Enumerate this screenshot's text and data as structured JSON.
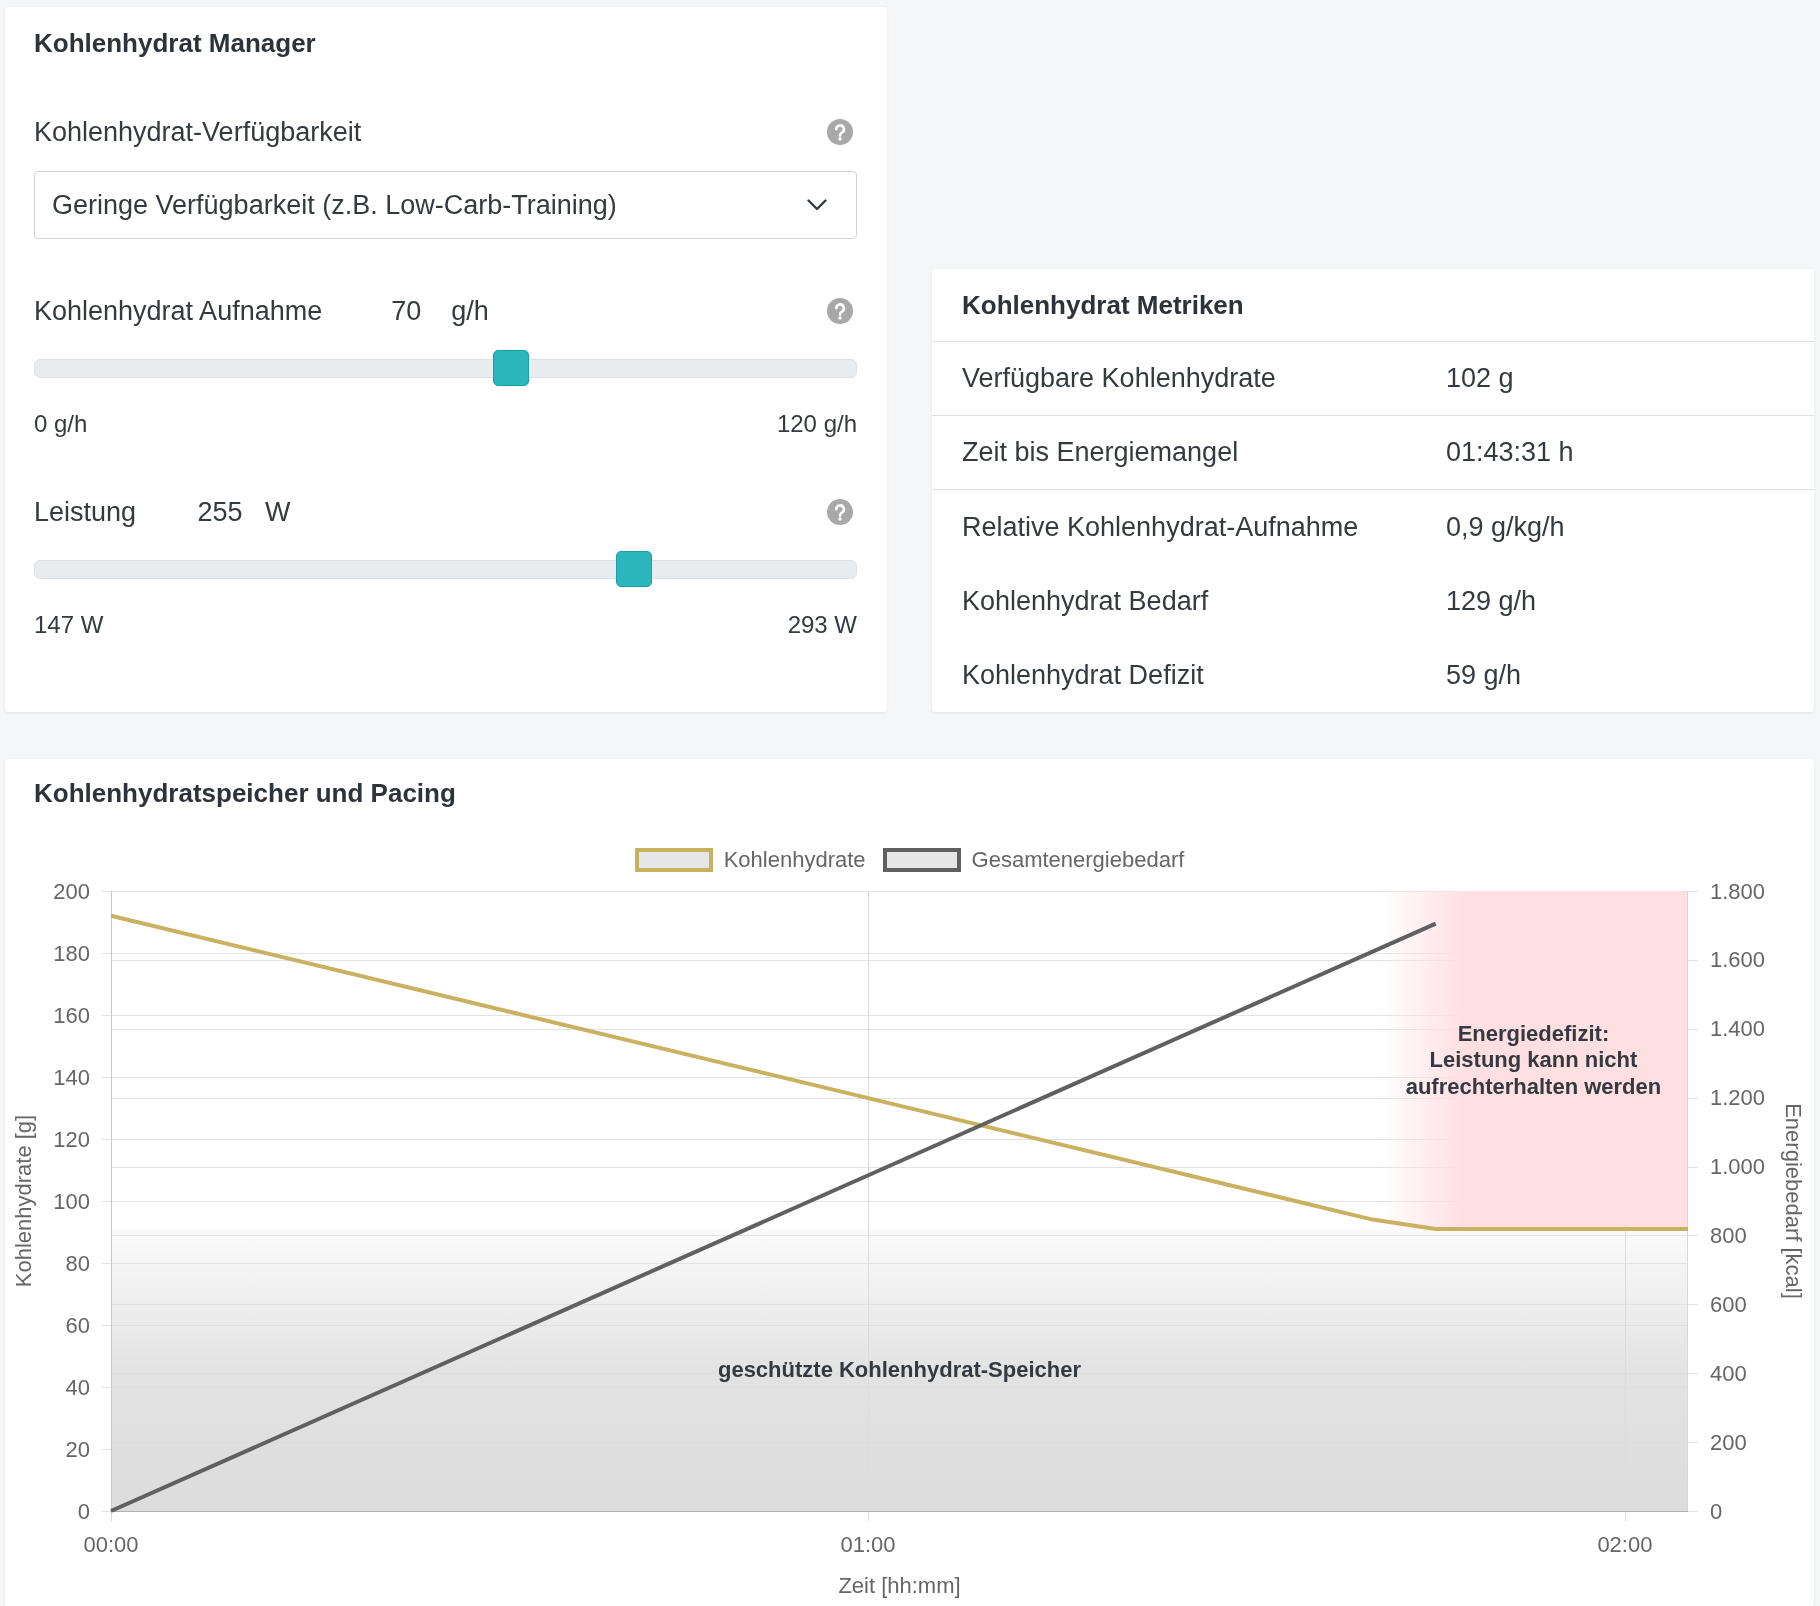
{
  "manager": {
    "title": "Kohlenhydrat Manager",
    "availability": {
      "label": "Kohlenhydrat-Verfügbarkeit",
      "value": "Geringe Verfügbarkeit (z.B. Low-Carb-Training)"
    },
    "sliders": [
      {
        "label": "Kohlenhydrat Aufnahme",
        "value": "70",
        "unit": "g/h",
        "min_label": "0 g/h",
        "max_label": "120 g/h",
        "level": 0.583
      },
      {
        "label": "Leistung",
        "value": "255",
        "unit": "W",
        "min_label": "147 W",
        "max_label": "293 W",
        "level": 0.74
      }
    ]
  },
  "metrics": {
    "title": "Kohlenhydrat Metriken",
    "rows": [
      {
        "label": "Verfügbare Kohlenhydrate",
        "value": "102 g",
        "divider_below": true
      },
      {
        "label": "Zeit bis Energiemangel",
        "value": "01:43:31 h",
        "divider_below": true
      },
      {
        "label": "Relative Kohlenhydrat-Aufnahme",
        "value": "0,9 g/kg/h",
        "divider_below": false
      },
      {
        "label": "Kohlenhydrat Bedarf",
        "value": "129 g/h",
        "divider_below": false
      },
      {
        "label": "Kohlenhydrat Defizit",
        "value": "59 g/h",
        "divider_below": false
      }
    ]
  },
  "pacing": {
    "title": "Kohlenhydratspeicher und Pacing",
    "chart_data": {
      "type": "line",
      "xlabel": "Zeit [hh:mm]",
      "ylabel": "Kohlenhydrate [g]",
      "y2label": "Energiebedarf [kcal]",
      "x": [
        0,
        100,
        105,
        125
      ],
      "series": [
        {
          "name": "Kohlenhydrate",
          "color": "#c9b160",
          "values": [
            192,
            94,
            91,
            91
          ]
        },
        {
          "name": "Gesamtenergiebedarf",
          "color": "#606060",
          "axis": "y2",
          "values": [
            0,
            1624,
            1705,
            null
          ]
        }
      ],
      "xlim": [
        0,
        125
      ],
      "ylim": [
        0,
        200
      ],
      "y2lim": [
        0,
        1800
      ],
      "xticks": [
        {
          "value": 0,
          "label": "00:00"
        },
        {
          "value": 60,
          "label": "01:00"
        },
        {
          "value": 120,
          "label": "02:00"
        }
      ],
      "yticks": [
        0,
        20,
        40,
        60,
        80,
        100,
        120,
        140,
        160,
        180,
        200
      ],
      "y2ticks": [
        0,
        200,
        400,
        600,
        800,
        {
          "value": 1000,
          "label": "1.000"
        },
        {
          "value": 1200,
          "label": "1.200"
        },
        {
          "value": 1400,
          "label": "1.400"
        },
        {
          "value": 1600,
          "label": "1.600"
        },
        {
          "value": 1800,
          "label": "1.800"
        }
      ],
      "grid": true,
      "bands": [
        {
          "axis": "x",
          "from": 100.5,
          "to": 125,
          "color": "#ffdfe2",
          "label": "Energiedefizit:\nLeistung kann nicht\naufrechterhalten werden"
        },
        {
          "axis": "y",
          "from": 0,
          "to": 91,
          "color": "#dcdcdc",
          "label": "geschützte Kohlenhydrat-Speicher"
        }
      ]
    }
  }
}
